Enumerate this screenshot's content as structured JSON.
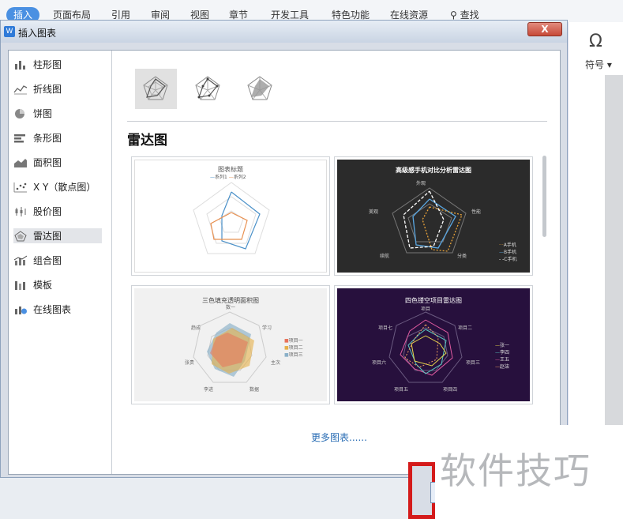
{
  "ribbon": {
    "tabs": [
      "插入",
      "页面布局",
      "引用",
      "审阅",
      "视图",
      "章节",
      "开发工具",
      "特色功能",
      "在线资源"
    ],
    "search_label": "查找",
    "symbol_label": "符号"
  },
  "dialog": {
    "title": "插入图表",
    "close_label": "X",
    "sidebar": [
      {
        "label": "柱形图",
        "icon": "column-chart-icon"
      },
      {
        "label": "折线图",
        "icon": "line-chart-icon"
      },
      {
        "label": "饼图",
        "icon": "pie-chart-icon"
      },
      {
        "label": "条形图",
        "icon": "bar-chart-icon"
      },
      {
        "label": "面积图",
        "icon": "area-chart-icon"
      },
      {
        "label": "X Y（散点图）",
        "icon": "scatter-chart-icon"
      },
      {
        "label": "股价图",
        "icon": "stock-chart-icon"
      },
      {
        "label": "雷达图",
        "icon": "radar-chart-icon",
        "selected": true
      },
      {
        "label": "组合图",
        "icon": "combo-chart-icon"
      },
      {
        "label": "模板",
        "icon": "template-icon"
      },
      {
        "label": "在线图表",
        "icon": "online-chart-icon"
      }
    ],
    "section_title": "雷达图",
    "templates": [
      {
        "title": "图表标题",
        "legend": [
          "系列1",
          "系列2"
        ]
      },
      {
        "title": "高级感手机对比分析雷达图",
        "axes": [
          "外观",
          "性能",
          "分类",
          "续航",
          "美观"
        ],
        "legend": [
          "A手机",
          "B手机",
          "C手机"
        ]
      },
      {
        "title": "三色填充透明面积图",
        "axes": [
          "数一",
          "学习",
          "主次",
          "数据",
          "李进",
          "张贵",
          "趋成"
        ],
        "legend": [
          "项目一",
          "项目二",
          "项目三"
        ]
      },
      {
        "title": "四色镂空项目雷达图",
        "axes": [
          "项目",
          "项目二",
          "项目三",
          "项目四",
          "项目五",
          "项目六",
          "项目七"
        ],
        "legend": [
          "张一",
          "李四",
          "王五",
          "赵柒"
        ]
      }
    ],
    "more_link": "更多图表......",
    "colors": {
      "accent": "#4a90e2",
      "selection": "#e3e5e9",
      "close": "#c74a38",
      "highlight": "#d41b1b"
    }
  },
  "watermark": "软件技巧"
}
